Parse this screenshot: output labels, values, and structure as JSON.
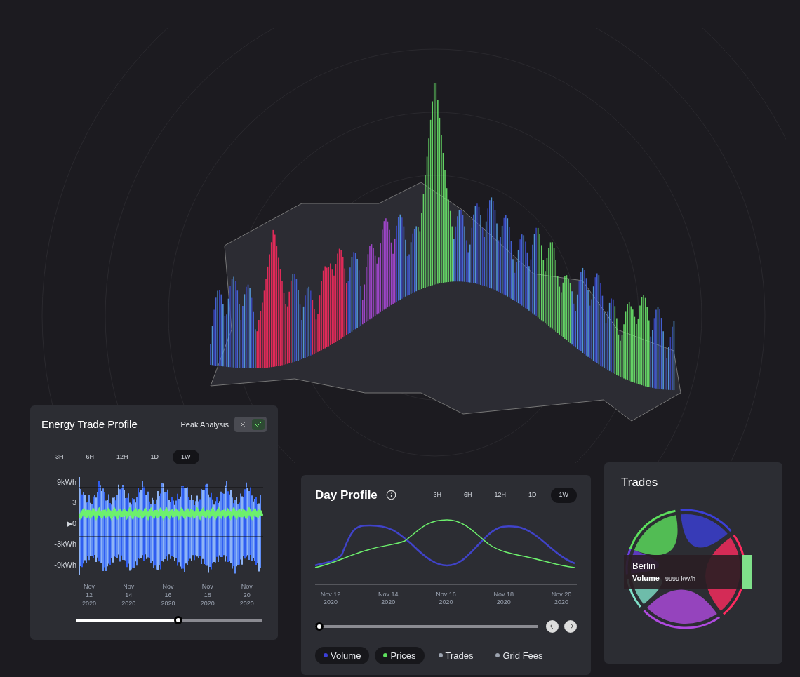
{
  "energy_trade_profile": {
    "title": "Energy Trade Profile",
    "peak_analysis": {
      "label": "Peak Analysis",
      "on": true
    },
    "ranges": [
      {
        "label": "3H",
        "selected": false
      },
      {
        "label": "6H",
        "selected": false
      },
      {
        "label": "12H",
        "selected": false
      },
      {
        "label": "1D",
        "selected": false
      },
      {
        "label": "1W",
        "selected": true
      }
    ],
    "y_labels": [
      "9kWh",
      "3",
      "▶0",
      "-3kWh",
      "-9kWh"
    ],
    "x_labels": [
      "Nov 12 2020",
      "Nov 14 2020",
      "Nov 16 2020",
      "Nov 18 2020",
      "Nov 20 2020"
    ],
    "slider": {
      "level": 0.55
    }
  },
  "day_profile": {
    "title": "Day Profile",
    "ranges": [
      {
        "label": "3H",
        "selected": false
      },
      {
        "label": "6H",
        "selected": false
      },
      {
        "label": "12H",
        "selected": false
      },
      {
        "label": "1D",
        "selected": false
      },
      {
        "label": "1W",
        "selected": true
      }
    ],
    "x_labels": [
      "Nov 12 2020",
      "Nov 14 2020",
      "Nov 16 2020",
      "Nov 18 2020",
      "Nov 20 2020"
    ],
    "slider": {
      "level": 0
    },
    "legend": [
      {
        "label": "Volume",
        "color": "#3b3fd8",
        "selected": true
      },
      {
        "label": "Prices",
        "color": "#5de05d",
        "selected": true
      },
      {
        "label": "Trades",
        "color": "#9ca3af",
        "selected": false
      },
      {
        "label": "Grid Fees",
        "color": "#9ca3af",
        "selected": false
      }
    ]
  },
  "trades": {
    "title": "Trades",
    "tooltip": {
      "name": "Berlin",
      "label": "Volume",
      "value": "9999 kW/h"
    }
  }
}
